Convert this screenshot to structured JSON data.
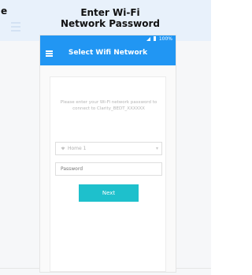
{
  "edge_char": "e",
  "page_title_lines": [
    "Enter Wi-Fi",
    "Network Password"
  ],
  "status_bar": {
    "battery": "100%"
  },
  "app_bar": {
    "title": "Select Wifi Network"
  },
  "instructions": "Please enter your Wi-Fi network password to connect to Clarity_BEDT_XXXXXX",
  "ssid_field": {
    "value": "Home 1"
  },
  "password_field": {
    "placeholder": "Password"
  },
  "next_button": {
    "label": "Next"
  },
  "colors": {
    "primary": "#2196f3",
    "next_button": "#1ec0cc"
  }
}
